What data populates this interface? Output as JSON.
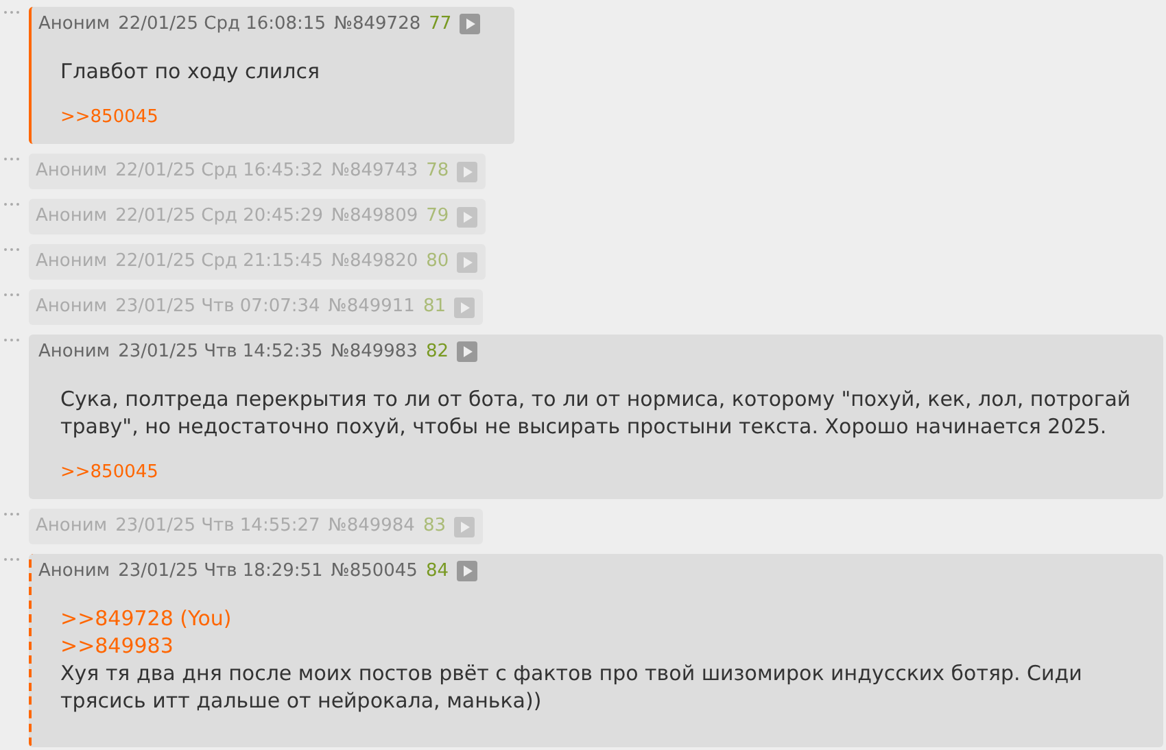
{
  "posts": [
    {
      "name": "Аноним",
      "date": "22/01/25 Срд 16:08:15",
      "number": "№849728",
      "index": "77",
      "collapsed": false,
      "own_post": true,
      "reply_to_you": false,
      "body": [
        {
          "kind": "text",
          "text": "Главбот по ходу слился"
        }
      ],
      "replies": [
        ">>850045"
      ]
    },
    {
      "name": "Аноним",
      "date": "22/01/25 Срд 16:45:32",
      "number": "№849743",
      "index": "78",
      "collapsed": true
    },
    {
      "name": "Аноним",
      "date": "22/01/25 Срд 20:45:29",
      "number": "№849809",
      "index": "79",
      "collapsed": true
    },
    {
      "name": "Аноним",
      "date": "22/01/25 Срд 21:15:45",
      "number": "№849820",
      "index": "80",
      "collapsed": true
    },
    {
      "name": "Аноним",
      "date": "23/01/25 Чтв 07:07:34",
      "number": "№849911",
      "index": "81",
      "collapsed": true
    },
    {
      "name": "Аноним",
      "date": "23/01/25 Чтв 14:52:35",
      "number": "№849983",
      "index": "82",
      "collapsed": false,
      "own_post": false,
      "reply_to_you": false,
      "body": [
        {
          "kind": "text",
          "text": "Сука, полтреда перекрытия то ли от бота, то ли от нормиса, которому \"похуй, кек, лол, потрогай траву\", но недостаточно похуй, чтобы не высирать простыни текста. Хорошо начинается 2025."
        }
      ],
      "replies": [
        ">>850045"
      ]
    },
    {
      "name": "Аноним",
      "date": "23/01/25 Чтв 14:55:27",
      "number": "№849984",
      "index": "83",
      "collapsed": true
    },
    {
      "name": "Аноним",
      "date": "23/01/25 Чтв 18:29:51",
      "number": "№850045",
      "index": "84",
      "collapsed": false,
      "own_post": false,
      "reply_to_you": true,
      "body": [
        {
          "kind": "link",
          "text": ">>849728 (You)"
        },
        {
          "kind": "link",
          "text": ">>849983"
        },
        {
          "kind": "text",
          "text": "Хуя тя два дня после моих постов рвёт с фактов про твой шизомирок индусских ботяр. Сиди трясись итт дальше от нейрокала, манька))"
        }
      ]
    }
  ]
}
